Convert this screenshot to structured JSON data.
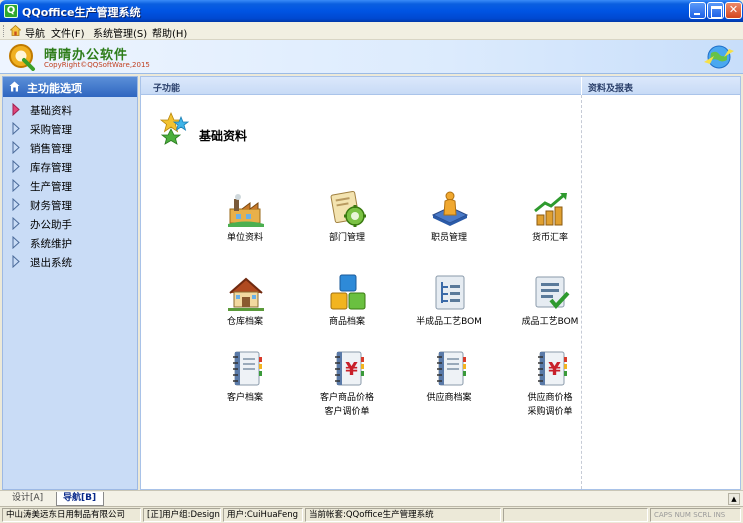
{
  "window": {
    "title": "QQoffice生产管理系统",
    "app_icon_glyph": "Q"
  },
  "menubar": {
    "items": [
      "导航",
      "文件(F)",
      "系统管理(S)",
      "帮助(H)"
    ]
  },
  "banner": {
    "logo_text": "晴晴办公软件",
    "copyright": "CopyRight©QQSoftWare,2015"
  },
  "left_panel": {
    "header": "主功能选项",
    "items": [
      "基础资料",
      "采购管理",
      "销售管理",
      "库存管理",
      "生产管理",
      "财务管理",
      "办公助手",
      "系统维护",
      "退出系统"
    ],
    "selected_index": 0
  },
  "content": {
    "sub_header": "子功能",
    "report_header": "资料及报表",
    "section_title": "基础资料",
    "tiles": [
      {
        "label": "单位资料",
        "icon": "factory-icon"
      },
      {
        "label": "部门管理",
        "icon": "department-gear-icon"
      },
      {
        "label": "职员管理",
        "icon": "employee-book-icon"
      },
      {
        "label": "货币汇率",
        "icon": "coins-growth-icon"
      },
      {
        "label": "仓库档案",
        "icon": "warehouse-house-icon"
      },
      {
        "label": "商品档案",
        "icon": "product-blocks-icon"
      },
      {
        "label": "半成品工艺BOM",
        "icon": "bom-tree-icon"
      },
      {
        "label": "成品工艺BOM",
        "icon": "bom-check-icon"
      },
      {
        "label": "客户档案",
        "icon": "notebook-icon"
      },
      {
        "label": "客户商品价格",
        "label2": "客户调价单",
        "icon": "yen-notebook-icon"
      },
      {
        "label": "供应商档案",
        "icon": "notebook-icon"
      },
      {
        "label": "供应商价格",
        "label2": "采购调价单",
        "icon": "yen-notebook-icon"
      }
    ]
  },
  "tabs": [
    "设计[A]",
    "导航[B]"
  ],
  "statusbar": {
    "company": "中山涛美远东日用制品有限公司",
    "user_group": "[正]用户组:Design",
    "user": "用户:CuiHuaFeng",
    "account": "当前帐套:QQoffice生产管理系统",
    "keys": "CAPS NUM SCRL INS"
  },
  "colors": {
    "titlebar": "#0054e3",
    "left_panel_bg": "#c9dcf6",
    "left_header": "#2f66c0",
    "selected_arrow": "#e0457a"
  }
}
